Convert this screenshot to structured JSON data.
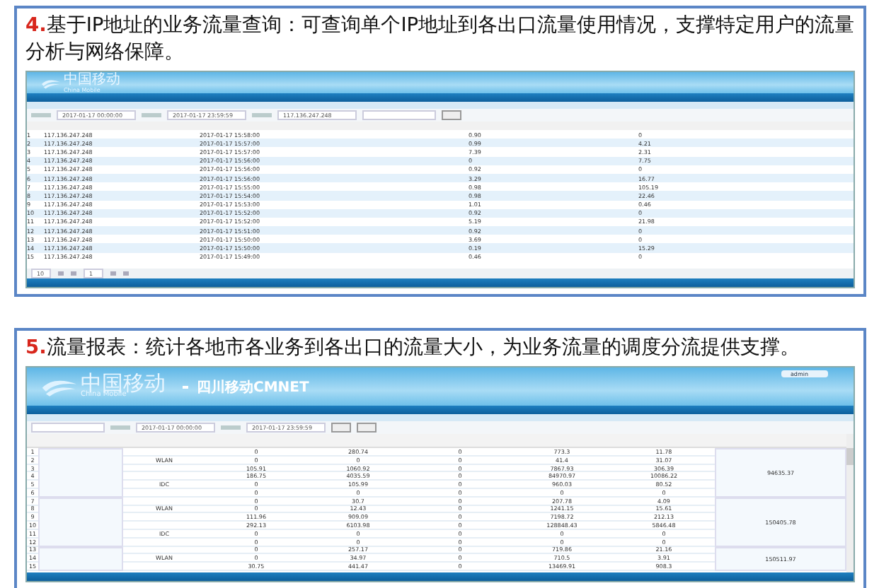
{
  "panels": [
    {
      "number": "4.",
      "caption": "基于IP地址的业务流量查询：可查询单个IP地址到各出口流量使用情况，支撑特定用户的流量分析与网络保障。",
      "screenshot": {
        "kind": "query",
        "logo": "中国移动",
        "logo_sub": "China Mobile",
        "filters": [
          "2017-01-17 00:00:00",
          "2017-01-17 23:59:59",
          "117.136.247.248"
        ],
        "rows": [
          [
            "1",
            "117.136.247.248",
            "2017-01-17 15:58:00",
            "0.90",
            "0"
          ],
          [
            "2",
            "117.136.247.248",
            "2017-01-17 15:57:00",
            "0.99",
            "4.21"
          ],
          [
            "3",
            "117.136.247.248",
            "2017-01-17 15:57:00",
            "7.39",
            "2.31"
          ],
          [
            "4",
            "117.136.247.248",
            "2017-01-17 15:56:00",
            "0",
            "7.75"
          ],
          [
            "5",
            "117.136.247.248",
            "2017-01-17 15:56:00",
            "0.92",
            "0"
          ],
          [
            "6",
            "117.136.247.248",
            "2017-01-17 15:56:00",
            "3.29",
            "16.77"
          ],
          [
            "7",
            "117.136.247.248",
            "2017-01-17 15:55:00",
            "0.98",
            "105.19"
          ],
          [
            "8",
            "117.136.247.248",
            "2017-01-17 15:54:00",
            "0.98",
            "22.46"
          ],
          [
            "9",
            "117.136.247.248",
            "2017-01-17 15:53:00",
            "1.01",
            "0.46"
          ],
          [
            "10",
            "117.136.247.248",
            "2017-01-17 15:52:00",
            "0.92",
            "0"
          ],
          [
            "11",
            "117.136.247.248",
            "2017-01-17 15:52:00",
            "5.19",
            "21.98"
          ],
          [
            "12",
            "117.136.247.248",
            "2017-01-17 15:51:00",
            "0.92",
            "0"
          ],
          [
            "13",
            "117.136.247.248",
            "2017-01-17 15:50:00",
            "3.69",
            "0"
          ],
          [
            "14",
            "117.136.247.248",
            "2017-01-17 15:50:00",
            "0.19",
            "15.29"
          ],
          [
            "15",
            "117.136.247.248",
            "2017-01-17 15:49:00",
            "0.46",
            "0"
          ]
        ],
        "page_size": "10",
        "page": "1"
      }
    },
    {
      "number": "5.",
      "caption": "流量报表：统计各地市各业务到各出口的流量大小，为业务流量的调度分流提供支撑。",
      "screenshot": {
        "kind": "report",
        "logo": "中国移动",
        "logo_sub": "China Mobile",
        "title": "四川移动CMNET",
        "user": "admin",
        "filters": [
          "2017-01-17 00:00:00",
          "2017-01-17 23:59:59"
        ],
        "rows": [
          [
            "1",
            "",
            "0",
            "280.74",
            "0",
            "773.3",
            "11.78"
          ],
          [
            "2",
            "WLAN",
            "0",
            "0",
            "0",
            "41.4",
            "31.07"
          ],
          [
            "3",
            "",
            "105.91",
            "1060.92",
            "0",
            "7867.93",
            "306.39"
          ],
          [
            "4",
            "",
            "186.75",
            "4035.59",
            "0",
            "84970.97",
            "10086.22"
          ],
          [
            "5",
            "IDC",
            "0",
            "105.99",
            "0",
            "960.03",
            "80.52"
          ],
          [
            "6",
            "",
            "0",
            "0",
            "0",
            "0",
            "0"
          ],
          [
            "7",
            "",
            "0",
            "30.7",
            "0",
            "207.78",
            "4.09"
          ],
          [
            "8",
            "WLAN",
            "0",
            "12.43",
            "0",
            "1241.15",
            "15.61"
          ],
          [
            "9",
            "",
            "111.96",
            "909.09",
            "0",
            "7198.72",
            "212.13"
          ],
          [
            "10",
            "",
            "292.13",
            "6103.98",
            "0",
            "128848.43",
            "5846.48"
          ],
          [
            "11",
            "IDC",
            "0",
            "0",
            "0",
            "0",
            "0"
          ],
          [
            "12",
            "",
            "0",
            "0",
            "0",
            "0",
            "0"
          ],
          [
            "13",
            "",
            "0",
            "257.17",
            "0",
            "719.86",
            "21.16"
          ],
          [
            "14",
            "WLAN",
            "0",
            "34.97",
            "0",
            "710.5",
            "3.91"
          ],
          [
            "15",
            "",
            "30.75",
            "441.47",
            "0",
            "13469.91",
            "908.3"
          ]
        ],
        "totals": [
          "94635.37",
          "150405.78",
          "150511.97"
        ]
      }
    }
  ]
}
